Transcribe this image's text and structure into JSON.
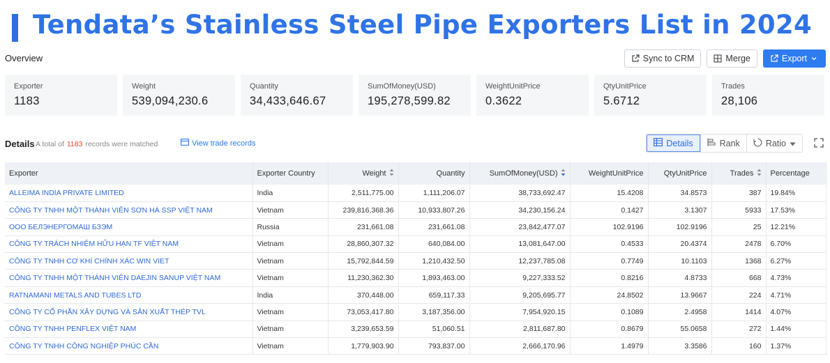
{
  "banner": {
    "title": "Tendata’s Stainless Steel Pipe Exporters List in 2024"
  },
  "overview": {
    "label": "Overview"
  },
  "toolbar": {
    "sync_label": "Sync to CRM",
    "merge_label": "Merge",
    "export_label": "Export"
  },
  "stats": [
    {
      "label": "Exporter",
      "value": "1183"
    },
    {
      "label": "Weight",
      "value": "539,094,230.6"
    },
    {
      "label": "Quantity",
      "value": "34,433,646.67"
    },
    {
      "label": "SumOfMoney(USD)",
      "value": "195,278,599.82"
    },
    {
      "label": "WeightUnitPrice",
      "value": "0.3622"
    },
    {
      "label": "QtyUnitPrice",
      "value": "5.6712"
    },
    {
      "label": "Trades",
      "value": "28,106"
    }
  ],
  "details": {
    "label": "Details",
    "total_prefix": "A total of",
    "total_count": "1183",
    "total_suffix": "records were matched",
    "view_trade_label": "View trade records",
    "tabs": {
      "details": "Details",
      "rank": "Rank",
      "ratio": "Ratio"
    }
  },
  "table": {
    "headers": {
      "exporter": "Exporter",
      "country": "Exporter Country",
      "weight": "Weight",
      "quantity": "Quantity",
      "sum": "SumOfMoney(USD)",
      "wup": "WeightUnitPrice",
      "qup": "QtyUnitPrice",
      "trades": "Trades",
      "pct": "Percentage"
    },
    "rows": [
      {
        "exporter": "ALLEIMA INDIA PRIVATE LIMITED",
        "country": "India",
        "weight": "2,511,775.00",
        "quantity": "1,111,206.07",
        "sum": "38,733,692.47",
        "wup": "15.4208",
        "qup": "34.8573",
        "trades": "387",
        "pct": "19.84%"
      },
      {
        "exporter": "CÔNG TY TNHH MỘT THÀNH VIÊN SƠN HÀ SSP VIỆT NAM",
        "country": "Vietnam",
        "weight": "239,816,368.36",
        "quantity": "10,933,807.26",
        "sum": "34,230,156.24",
        "wup": "0.1427",
        "qup": "3.1307",
        "trades": "5933",
        "pct": "17.53%"
      },
      {
        "exporter": "ООО БЕЛЭНЕРГОМАШ БЗЭМ",
        "country": "Russia",
        "weight": "231,661.08",
        "quantity": "231,661.08",
        "sum": "23,842,477.07",
        "wup": "102.9196",
        "qup": "102.9196",
        "trades": "25",
        "pct": "12.21%"
      },
      {
        "exporter": "CÔNG TY TRÁCH NHIỆM HỮU HẠN TF VIỆT NAM",
        "country": "Vietnam",
        "weight": "28,860,307.32",
        "quantity": "640,084.00",
        "sum": "13,081,647.00",
        "wup": "0.4533",
        "qup": "20.4374",
        "trades": "2478",
        "pct": "6.70%"
      },
      {
        "exporter": "CÔNG TY TNHH CƠ KHÍ CHÍNH XÁC WIN VIET",
        "country": "Vietnam",
        "weight": "15,792,844.59",
        "quantity": "1,210,432.50",
        "sum": "12,237,785.08",
        "wup": "0.7749",
        "qup": "10.1103",
        "trades": "1368",
        "pct": "6.27%"
      },
      {
        "exporter": "CÔNG TY TNHH MỘT THÀNH VIÊN DAEJIN SANUP VIỆT NAM",
        "country": "Vietnam",
        "weight": "11,230,362.30",
        "quantity": "1,893,463.00",
        "sum": "9,227,333.52",
        "wup": "0.8216",
        "qup": "4.8733",
        "trades": "668",
        "pct": "4.73%"
      },
      {
        "exporter": "RATNAMANI METALS AND TUBES LTD",
        "country": "India",
        "weight": "370,448.00",
        "quantity": "659,117.33",
        "sum": "9,205,695.77",
        "wup": "24.8502",
        "qup": "13.9667",
        "trades": "224",
        "pct": "4.71%"
      },
      {
        "exporter": "CÔNG TY CỔ PHẦN XÂY DỰNG VÀ SẢN XUẤT THÉP TVL",
        "country": "Vietnam",
        "weight": "73,053,417.80",
        "quantity": "3,187,356.00",
        "sum": "7,954,920.15",
        "wup": "0.1089",
        "qup": "2.4958",
        "trades": "1414",
        "pct": "4.07%"
      },
      {
        "exporter": "CÔNG TY TNHH PENFLEX VIỆT NAM",
        "country": "Vietnam",
        "weight": "3,239,653.59",
        "quantity": "51,060.51",
        "sum": "2,811,687.80",
        "wup": "0.8679",
        "qup": "55.0658",
        "trades": "272",
        "pct": "1.44%"
      },
      {
        "exporter": "CÔNG TY TNHH CÔNG NGHIỆP PHÚC CẦN",
        "country": "Vietnam",
        "weight": "1,779,903.90",
        "quantity": "793,837.00",
        "sum": "2,666,170.96",
        "wup": "1.4979",
        "qup": "3.3586",
        "trades": "160",
        "pct": "1.37%"
      }
    ]
  },
  "colors": {
    "accent": "#2d7cf0",
    "title": "#2f73e6",
    "count": "#e0482e"
  }
}
